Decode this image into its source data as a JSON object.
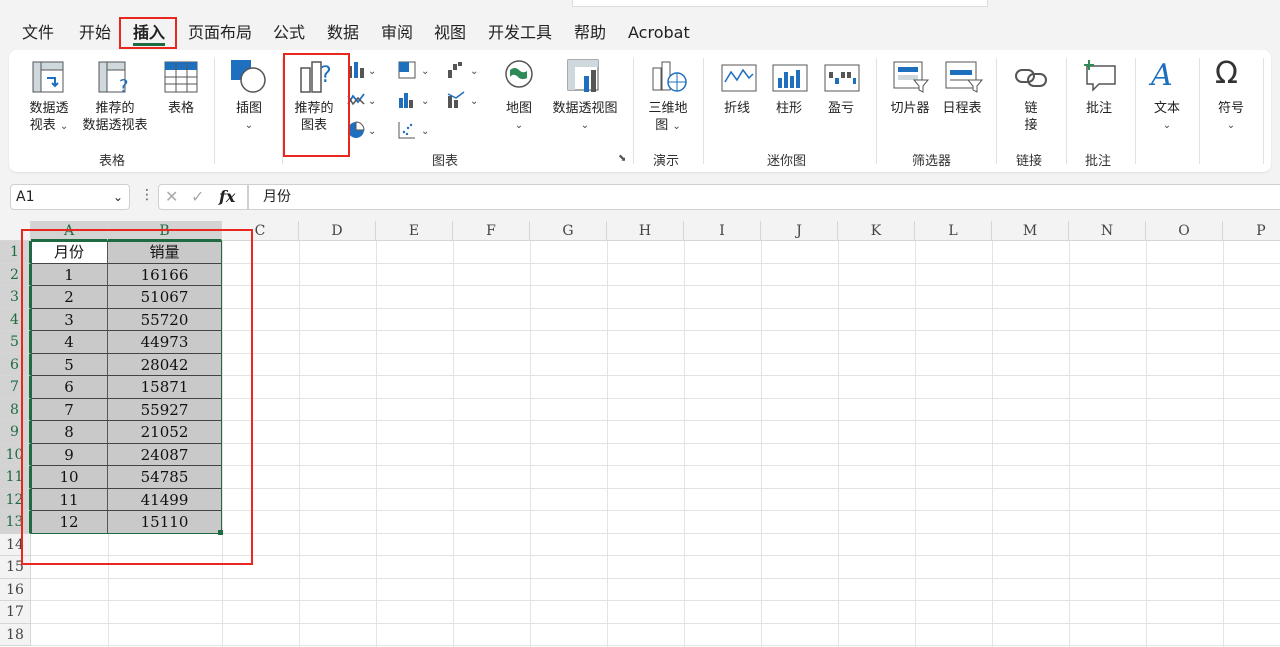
{
  "menu": {
    "tabs": [
      "文件",
      "开始",
      "插入",
      "页面布局",
      "公式",
      "数据",
      "审阅",
      "视图",
      "开发工具",
      "帮助",
      "Acrobat"
    ],
    "active_tab": "插入"
  },
  "ribbon": {
    "pivot_table": [
      "数据透",
      "视表"
    ],
    "recommended_pivot": [
      "推荐的",
      "数据透视表"
    ],
    "table": "表格",
    "illustrations": "插图",
    "recommended_charts": [
      "推荐的",
      "图表"
    ],
    "maps": "地图",
    "pivot_chart": "数据透视图",
    "map3d": [
      "三维地",
      "图"
    ],
    "spark_line": "折线",
    "spark_column": "柱形",
    "spark_winloss": "盈亏",
    "slicer": "切片器",
    "timeline": "日程表",
    "link": [
      "链",
      "接"
    ],
    "comment": "批注",
    "text": "文本",
    "symbol": "符号",
    "groups": {
      "tables": "表格",
      "charts": "图表",
      "tours": "演示",
      "sparklines": "迷你图",
      "filters": "筛选器",
      "links": "链接",
      "comments": "批注"
    }
  },
  "formula_bar": {
    "name_box": "A1",
    "fx": "fx",
    "content": "月份"
  },
  "sheet": {
    "columns": [
      "A",
      "B",
      "C",
      "D",
      "E",
      "F",
      "G",
      "H",
      "I",
      "J",
      "K",
      "L",
      "M",
      "N",
      "O",
      "P"
    ],
    "rows": [
      "1",
      "2",
      "3",
      "4",
      "5",
      "6",
      "7",
      "8",
      "9",
      "10",
      "11",
      "12",
      "13",
      "14",
      "15",
      "16",
      "17",
      "18"
    ],
    "headers": [
      "月份",
      "销量"
    ],
    "data": [
      [
        "1",
        "16166"
      ],
      [
        "2",
        "51067"
      ],
      [
        "3",
        "55720"
      ],
      [
        "4",
        "44973"
      ],
      [
        "5",
        "28042"
      ],
      [
        "6",
        "15871"
      ],
      [
        "7",
        "55927"
      ],
      [
        "8",
        "21052"
      ],
      [
        "9",
        "24087"
      ],
      [
        "10",
        "54785"
      ],
      [
        "11",
        "41499"
      ],
      [
        "12",
        "15110"
      ]
    ]
  },
  "colors": {
    "accent": "#1f6b41",
    "highlight": "#e8271e",
    "cell_shade": "#c9c9c9"
  }
}
